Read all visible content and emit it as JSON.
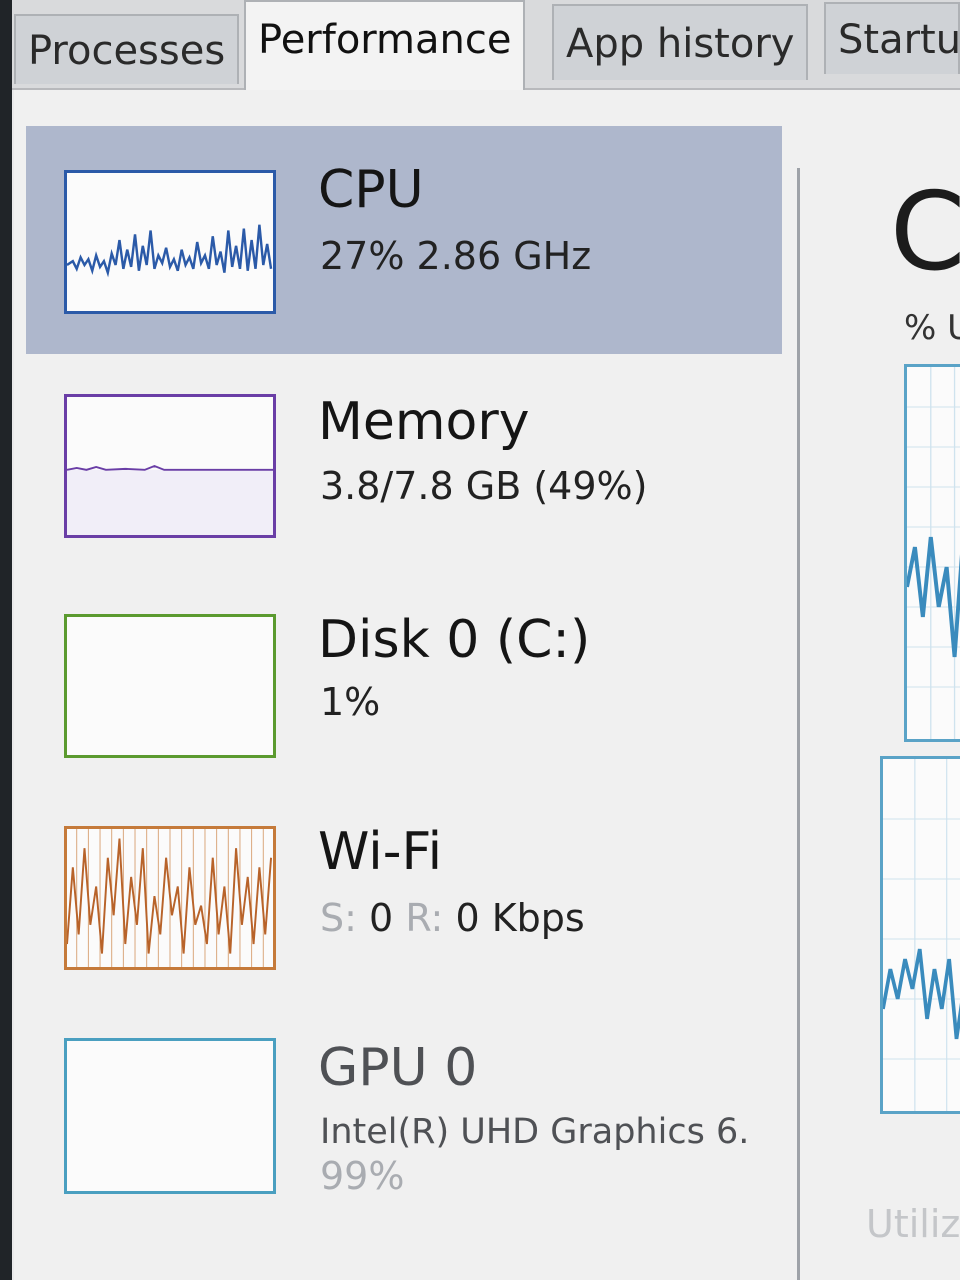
{
  "tabs": [
    {
      "label": "Processes"
    },
    {
      "label": "Performance"
    },
    {
      "label": "App history"
    },
    {
      "label": "Startu"
    }
  ],
  "resources": [
    {
      "title": "CPU",
      "detail": "27% 2.86 GHz",
      "color": "#2b5aa8"
    },
    {
      "title": "Memory",
      "detail": "3.8/7.8 GB (49%)",
      "color": "#6a3ea6"
    },
    {
      "title": "Disk 0 (C:)",
      "detail": "1%",
      "color": "#5b9a2f"
    },
    {
      "title": "Wi-Fi",
      "detail_send_label": "S:",
      "detail_send_value": "0",
      "detail_recv_label": "R:",
      "detail_recv_value": "0 Kbps",
      "color": "#c57a3a"
    },
    {
      "title": "GPU 0",
      "detail": "Intel(R) UHD Graphics 6.",
      "detail2": "99%",
      "color": "#4a9fc0"
    }
  ],
  "detail_pane": {
    "title": "C",
    "graph_label": "% U",
    "footer_label": "Utiliz",
    "graph_color": "#5aa3c7"
  }
}
